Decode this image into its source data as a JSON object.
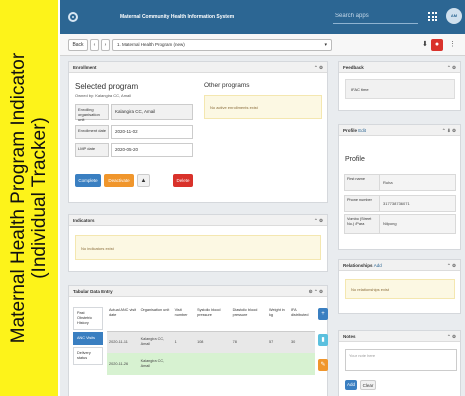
{
  "banner": {
    "line1": "Maternal Health Program Indicator",
    "line2": "(Individual Tracker)"
  },
  "topbar": {
    "app_title": "Maternal Community Health Information System",
    "search_placeholder": "Search apps",
    "avatar_initials": "AM"
  },
  "subbar": {
    "back_label": "Back",
    "prev_label": "‹",
    "next_label": "›",
    "program_selected": "1. Maternal Health Program (new)",
    "caret": "▾",
    "download_glyph": "⬇",
    "delete_glyph": "●",
    "more_glyph": "⋮"
  },
  "enrollment": {
    "header": "Enrollment",
    "controls": "⌃ ⚙",
    "title": "Selected program",
    "owned_by": "Owned by: Kalangira CC, Amail",
    "org_label": "Enrolling organisation unit",
    "org_value": "Kalangira CC, Amail",
    "enroll_date_label": "Enrollment date",
    "enroll_date_value": "2020-11-02",
    "lmp_label": "LMP date",
    "lmp_value": "2020-05-20",
    "complete_label": "Complete",
    "deactivate_label": "Deactivate",
    "warning_glyph": "▲",
    "delete_label": "Delete",
    "other_programs_title": "Other programs",
    "other_programs_empty": "No active enrollments exist"
  },
  "indicators": {
    "header": "Indicators",
    "controls": "⌃ ⚙",
    "empty": "No indicators exist"
  },
  "tabular": {
    "header": "Tabular Data Entry",
    "controls": "⚙ ⌃ ⚙",
    "stages": [
      {
        "label": "Past Obstetric History"
      },
      {
        "label": "ANC Visits"
      },
      {
        "label": "Delivery status"
      }
    ],
    "columns": [
      "Actual ANC visit date",
      "Organisation unit",
      "Visit number",
      "Systolic blood pressure",
      "Diastolic blood pressure",
      "Weight in kg",
      "IFA distributed"
    ],
    "rows": [
      [
        "2020-11-11",
        "Kalangira CC, Amail",
        "1",
        "108",
        "78",
        "57",
        "30"
      ],
      [
        "2020-11-26",
        "Kalangira CC, Amail",
        "",
        "",
        "",
        "",
        ""
      ]
    ],
    "add_glyph": "+",
    "trash_glyph": "▮",
    "edit_glyph": "✎"
  },
  "feedback": {
    "header": "Feedback",
    "controls": "⌃ ⚙",
    "value": "IFAC time"
  },
  "profile": {
    "header": "Profile",
    "edit_link": "Edit",
    "controls": "⌃ ⬇ ⚙",
    "title": "Profile",
    "first_name_label": "First name",
    "first_name_value": "Ruha",
    "phone_label": "Phone number",
    "phone_value": "317738736071",
    "mobile_label": "Vombo (Street No.) /Para",
    "mobile_value": "Nilpong"
  },
  "relationships": {
    "header": "Relationships",
    "add_link": "Add",
    "controls": "⌃ ⚙",
    "empty": "No relationships exist"
  },
  "notes": {
    "header": "Notes",
    "controls": "⌃ ⚙",
    "placeholder": "Your note here",
    "add_label": "Add",
    "clear_label": "Clear"
  }
}
